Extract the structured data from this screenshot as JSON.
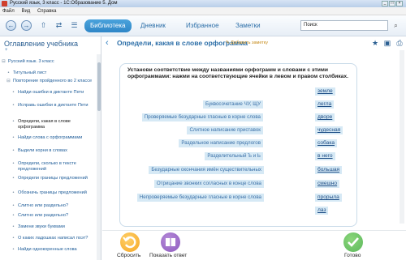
{
  "window": {
    "title": "Русский язык, 3 класс - 1С:Образование 5. Дом"
  },
  "menu": [
    "Файл",
    "Вид",
    "Справка"
  ],
  "toolbar": {
    "tabs": [
      {
        "label": "Библиотека",
        "active": true
      },
      {
        "label": "Дневник",
        "active": false
      },
      {
        "label": "Избранное",
        "active": false
      },
      {
        "label": "Заметки",
        "active": false
      }
    ],
    "search_value": "Поиск"
  },
  "sidebar": {
    "title": "Оглавление учебника",
    "subtitle": "+",
    "items": [
      {
        "label": "Русский язык. 3 класс",
        "bullet": "⊟"
      },
      {
        "label": "Титульный лист",
        "bullet": "•"
      },
      {
        "label": "Повторение пройденного во 2 классе",
        "bullet": "⊟"
      },
      {
        "label": "Найди ошибки в диктанте Пети",
        "bullet": "•"
      },
      {
        "label": "Исправь ошибки в диктанте Пети",
        "bullet": "•"
      },
      {
        "label": "Определи, какая в слове орфограмма",
        "bullet": "•",
        "selected": true
      },
      {
        "label": "Найди слова с орфограммами",
        "bullet": "•"
      },
      {
        "label": "Выдели корни в словах",
        "bullet": "•"
      },
      {
        "label": "Определи, сколько в тексте предложений",
        "bullet": "•"
      },
      {
        "label": "Определи границы предложений",
        "bullet": "•"
      },
      {
        "label": "Обозначь границы предложений",
        "bullet": "•"
      },
      {
        "label": "Слитно или раздельно?",
        "bullet": "•"
      },
      {
        "label": "Слитно или раздельно?",
        "bullet": "•"
      },
      {
        "label": "Замени звуки буквами",
        "bullet": "•"
      },
      {
        "label": "О каких ладошках написал поэт?",
        "bullet": "•"
      },
      {
        "label": "Найди однокоренные слова",
        "bullet": "•"
      }
    ]
  },
  "main": {
    "title": "Определи, какая в слове орфограмма",
    "add_note": "Добавить заметку",
    "instruction": "Установи соответствие между названиями орфограмм и словами с этими орфограммами: нажми на соответствующие ячейки в левом и правом столбиках.",
    "rules": [
      "Буквосочетание ЧУ, ЩУ",
      "Проверяемые безударные гласные в корне слова",
      "Слитное написание приставок",
      "Раздельное написание предлогов",
      "Разделительный Ъ и Ь",
      "Безударные окончания имён существительных",
      "Отрицание звонких согласных в конце слова",
      "Непроверяемые безударные гласные в корне слова"
    ],
    "words": [
      "земле",
      "легла",
      "дворе",
      "чудесная",
      "собака",
      "в него",
      "большая",
      "смешно",
      "прорыла",
      "лаз"
    ]
  },
  "bottom": {
    "reset": "Сбросить",
    "show_answer": "Показать ответ",
    "done": "Готово"
  },
  "colors": {
    "accent": "#2f86c7",
    "rule_bg": "#d6e9f5",
    "reset": "#f5a623",
    "show": "#8e5bbf",
    "done": "#5cb85c"
  }
}
